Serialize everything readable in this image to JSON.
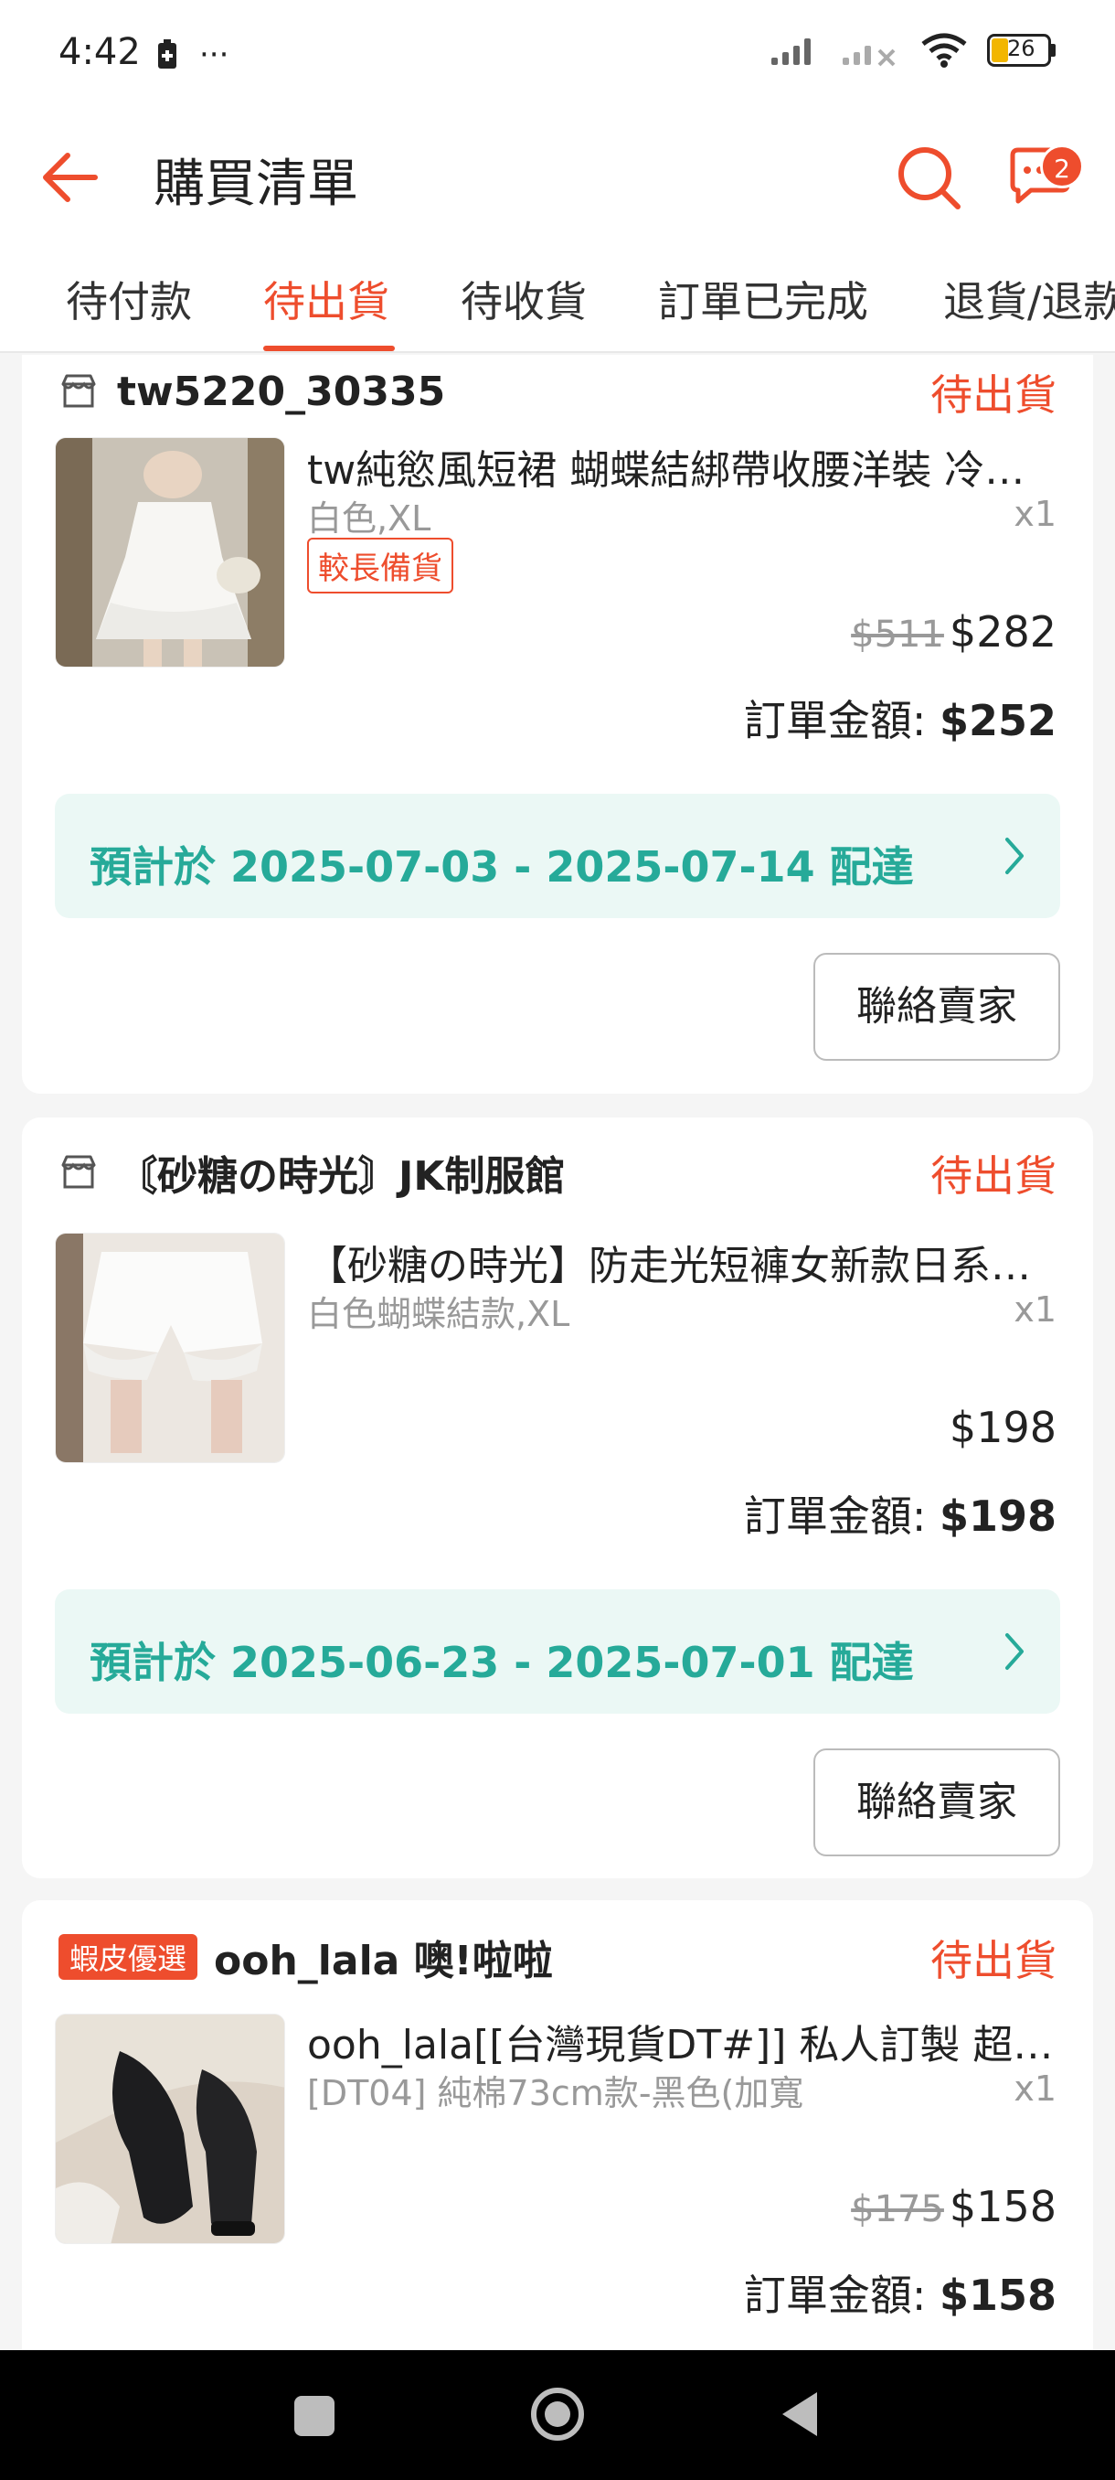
{
  "status_bar": {
    "time": "4:42",
    "dots": "···",
    "battery": "26"
  },
  "header": {
    "title": "購買清單",
    "chat_badge": "2"
  },
  "tabs": [
    {
      "label": "待付款",
      "active": false
    },
    {
      "label": "待出貨",
      "active": true
    },
    {
      "label": "待收貨",
      "active": false
    },
    {
      "label": "訂單已完成",
      "active": false
    },
    {
      "label": "退貨/退款",
      "active": false
    }
  ],
  "orders": [
    {
      "shop": "tw5220_30335",
      "status": "待出貨",
      "product": "tw純慾風短裙  蝴蝶結綁帶收腰洋裝  冷淡風吊帶連衣裙",
      "variant": "白色,XL",
      "qty": "x1",
      "badge": "較長備貨",
      "orig_price": "$511",
      "price": "$282",
      "total_label": "訂單金額: ",
      "total": "$252",
      "delivery": "預計於 2025-07-03 - 2025-07-14 配達",
      "contact": "聯絡賣家"
    },
    {
      "shop": "〘砂糖の時光〙JK制服館",
      "status": "待出貨",
      "product": "【砂糖の時光】防走光短褲女新款日系燈籠褲",
      "variant": "白色蝴蝶結款,XL",
      "qty": "x1",
      "price": "$198",
      "total_label": "訂單金額: ",
      "total": "$198",
      "delivery": "預計於 2025-06-23 - 2025-07-01 配達",
      "contact": "聯絡賣家"
    },
    {
      "shop_tag": "蝦皮優選",
      "shop": "ooh_lala 噢!啦啦",
      "status": "待出貨",
      "product": "ooh_lala[[台灣現貨DT#]] 私人訂製 超彈力加厚褲襪",
      "variant": "[DT04] 純棉73cm款-黑色(加寬",
      "qty": "x1",
      "orig_price": "$175",
      "price": "$158",
      "total_label": "訂單金額: ",
      "total": "$158"
    }
  ],
  "icons": {
    "back": "arrow-left-icon",
    "search": "search-icon",
    "chat": "chat-icon",
    "shop": "shop-icon",
    "chevron": "chevron-right-icon"
  },
  "colors": {
    "accent": "#ee4d2d",
    "delivery_text": "#26aa99",
    "delivery_bg": "#ebf8f5"
  }
}
